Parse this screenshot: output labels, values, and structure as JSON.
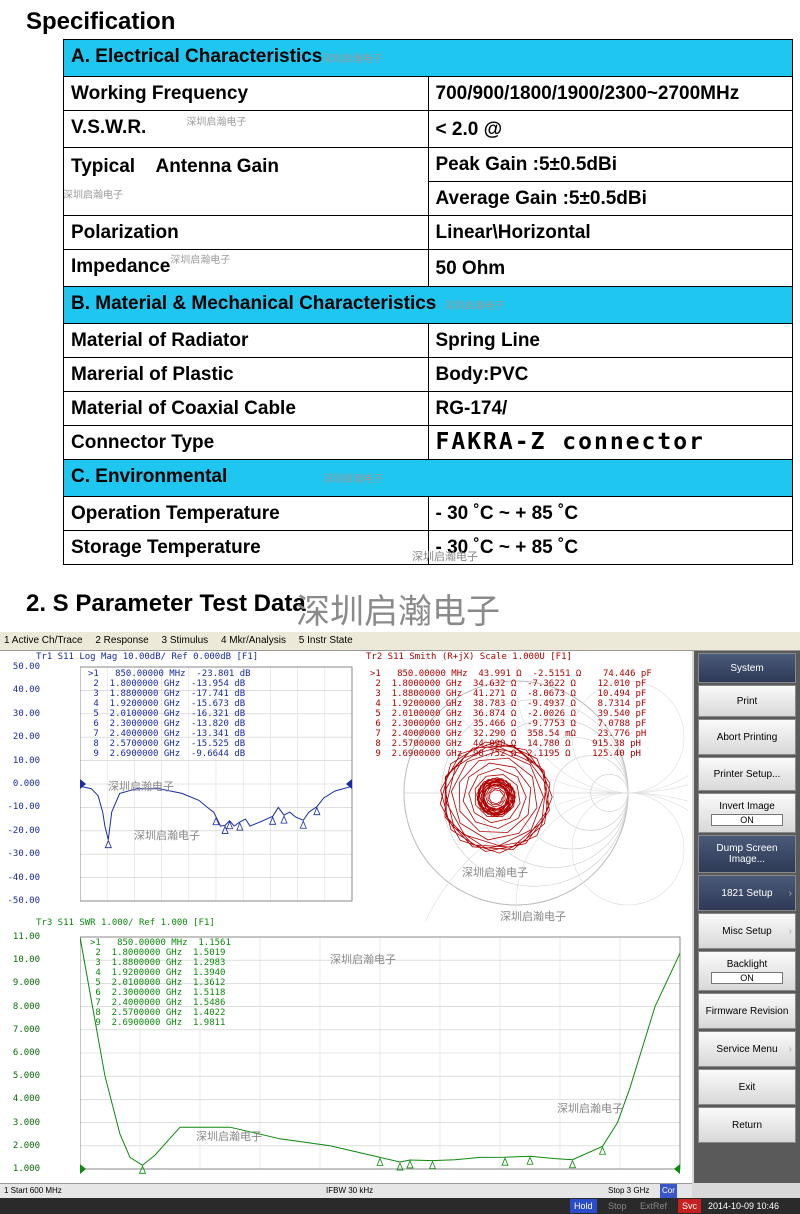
{
  "spec_heading": "Specification",
  "watermark": "深圳启瀚电子",
  "sections": [
    {
      "title": "A. Electrical Characteristics"
    },
    {
      "title": "B. Material & Mechanical Characteristics"
    },
    {
      "title": "C. Environmental"
    }
  ],
  "rows": {
    "working_frequency": {
      "label": "Working Frequency",
      "value": "700/900/1800/1900/2300~2700MHz"
    },
    "vswr": {
      "label": "V.S.W.R.",
      "value": "< 2.0 @"
    },
    "gain": {
      "label": "Typical    Antenna Gain",
      "value1": "Peak Gain :5±0.5dBi",
      "value2": "Average Gain :5±0.5dBi"
    },
    "polarization": {
      "label": "Polarization",
      "value": "Linear\\Horizontal"
    },
    "impedance": {
      "label": "Impedance",
      "value": "50 Ohm"
    },
    "radiator": {
      "label": "Material of Radiator",
      "value": "Spring Line"
    },
    "plastic": {
      "label": "Marerial of Plastic",
      "value": "Body:PVC"
    },
    "cable": {
      "label": "Material of Coaxial Cable",
      "value": "RG-174/"
    },
    "connector": {
      "label": "Connector Type",
      "value": "FAKRA-Z connector"
    },
    "op_temp": {
      "label": "Operation Temperature",
      "value": "- 30 ˚C ~ + 85 ˚C"
    },
    "st_temp": {
      "label": "Storage Temperature",
      "value": "- 30 ˚C ~ + 85 ˚C"
    }
  },
  "test_heading": "2. S Parameter Test Data",
  "vna": {
    "menu": [
      "1 Active Ch/Trace",
      "2 Response",
      "3 Stimulus",
      "4 Mkr/Analysis",
      "5 Instr State"
    ],
    "tr1_header": "Tr1  S11  Log Mag 10.00dB/ Ref 0.000dB [F1]",
    "tr2_header": "Tr2  S11  Smith (R+jX) Scale 1.000U [F1]",
    "tr3_header": "Tr3  S11  SWR 1.000/ Ref 1.000 [F1]",
    "tr1_ticks": [
      "50.00",
      "40.00",
      "30.00",
      "20.00",
      "10.00",
      "0.000",
      "-10.00",
      "-20.00",
      "-30.00",
      "-40.00",
      "-50.00"
    ],
    "tr3_ticks": [
      "11.00",
      "10.00",
      "9.000",
      "8.000",
      "7.000",
      "6.000",
      "5.000",
      "4.000",
      "3.000",
      "2.000",
      "1.000"
    ],
    "tr1_markers": [
      ">1   850.00000 MHz  -23.801 dB",
      " 2  1.8000000 GHz  -13.954 dB",
      " 3  1.8800000 GHz  -17.741 dB",
      " 4  1.9200000 GHz  -15.673 dB",
      " 5  2.0100000 GHz  -16.321 dB",
      " 6  2.3000000 GHz  -13.820 dB",
      " 7  2.4000000 GHz  -13.341 dB",
      " 8  2.5700000 GHz  -15.525 dB",
      " 9  2.6900000 GHz  -9.6644 dB"
    ],
    "tr2_markers": [
      ">1   850.00000 MHz  43.991 Ω  -2.5151 Ω    74.446 pF",
      " 2  1.8000000 GHz  34.632 Ω  -7.3622 Ω    12.010 pF",
      " 3  1.8800000 GHz  41.271 Ω  -8.0673 Ω    10.494 pF",
      " 4  1.9200000 GHz  38.783 Ω  -9.4937 Ω    8.7314 pF",
      " 5  2.0100000 GHz  36.874 Ω  -2.0026 Ω    39.540 pF",
      " 6  2.3000000 GHz  35.466 Ω  -9.7753 Ω    7.0788 pF",
      " 7  2.4000000 GHz  32.290 Ω  358.54 mΩ    23.776 pH",
      " 8  2.5700000 GHz  44.090 Ω  14.780 Ω    915.38 pH",
      " 9  2.6900000 GHz  98.752 Ω  2.1195 Ω    125.40 pH"
    ],
    "tr3_markers": [
      ">1   850.00000 MHz  1.1561",
      " 2  1.8000000 GHz  1.5019",
      " 3  1.8800000 GHz  1.2983",
      " 4  1.9200000 GHz  1.3940",
      " 5  2.0100000 GHz  1.3612",
      " 6  2.3000000 GHz  1.5118",
      " 7  2.4000000 GHz  1.5486",
      " 8  2.5700000 GHz  1.4022",
      " 9  2.6900000 GHz  1.9811"
    ],
    "side_buttons": [
      "System",
      "Print",
      "Abort Printing",
      "Printer Setup...",
      "Invert Image",
      "Dump Screen Image...",
      "1821 Setup",
      "Misc Setup",
      "Backlight",
      "Firmware Revision",
      "Service Menu",
      "Exit",
      "Return"
    ],
    "invert_state": "ON",
    "backlight_state": "ON",
    "status_left": "1  Start 600 MHz",
    "status_mid": "IFBW 30 kHz",
    "status_right": "Stop 3 GHz",
    "status_cor": "Cor",
    "task_hold": "Hold",
    "task_stop": "Stop",
    "task_extref": "ExtRef",
    "task_svc": "Svc",
    "task_time": "2014-10-09 10:46",
    "colors": {
      "tr1": "#1a2aa8",
      "tr2": "#b00000",
      "tr3": "#0a8a0a"
    }
  },
  "chart_data": [
    {
      "type": "line",
      "title": "Tr1 S11 Log Mag",
      "ylabel": "dB",
      "ylim": [
        -50,
        50
      ],
      "xlim_mhz": [
        600,
        3000
      ],
      "series": [
        {
          "x": [
            600,
            700,
            760,
            800,
            820,
            850,
            880,
            950,
            1100,
            1300,
            1500,
            1650,
            1750,
            1780,
            1800,
            1840,
            1880,
            1920,
            1960,
            2010,
            2060,
            2100,
            2200,
            2300,
            2350,
            2400,
            2450,
            2500,
            2570,
            2620,
            2690,
            2750,
            2850,
            3000
          ],
          "values": [
            -1,
            -2,
            -5,
            -12,
            -18,
            -23.8,
            -12,
            -4,
            -2,
            -2,
            -4,
            -7,
            -11,
            -12,
            -14,
            -18,
            -17.7,
            -15.7,
            -18,
            -16.3,
            -15,
            -18,
            -16,
            -13.8,
            -10,
            -13.3,
            -12,
            -14,
            -15.5,
            -12,
            -9.7,
            -6,
            -3,
            -1
          ]
        }
      ]
    },
    {
      "type": "line",
      "title": "Tr3 S11 SWR",
      "ylabel": "SWR",
      "ylim": [
        1,
        11
      ],
      "xlim_mhz": [
        600,
        3000
      ],
      "series": [
        {
          "x": [
            600,
            650,
            700,
            760,
            800,
            850,
            900,
            1000,
            1200,
            1400,
            1600,
            1800,
            1880,
            1920,
            2010,
            2100,
            2200,
            2300,
            2400,
            2500,
            2570,
            2690,
            2750,
            2800,
            2900,
            3000
          ],
          "values": [
            11,
            8,
            5,
            2.5,
            1.5,
            1.16,
            1.6,
            2.8,
            2.8,
            2.3,
            2,
            1.5,
            1.3,
            1.39,
            1.36,
            1.4,
            1.5,
            1.51,
            1.55,
            1.45,
            1.4,
            1.98,
            3,
            4.5,
            8,
            10.3
          ]
        }
      ]
    }
  ]
}
